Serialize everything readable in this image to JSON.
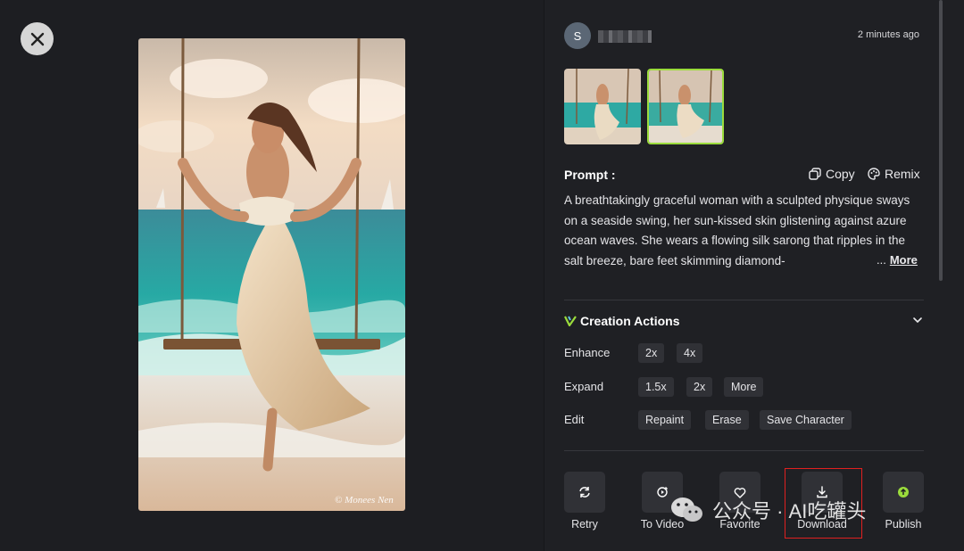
{
  "viewer": {
    "close_icon": "close-icon",
    "image_credit": "© Mοnees Nen"
  },
  "author": {
    "avatar_letter": "S",
    "timestamp": "2 minutes ago"
  },
  "prompt": {
    "title": "Prompt :",
    "copy_label": "Copy",
    "remix_label": "Remix",
    "text": "A breathtakingly graceful woman with a sculpted physique sways on a seaside swing, her sun-kissed skin glistening against azure ocean waves. She wears a flowing silk sarong that ripples in the salt breeze, bare feet skimming diamond-",
    "ellipsis": "...",
    "more_label": "More"
  },
  "creation_actions": {
    "title": "Creation Actions",
    "enhance": {
      "label": "Enhance",
      "options": [
        "2x",
        "4x"
      ]
    },
    "expand": {
      "label": "Expand",
      "options": [
        "1.5x",
        "2x",
        "More"
      ]
    },
    "edit": {
      "label": "Edit",
      "options": [
        "Repaint",
        "Erase",
        "Save Character"
      ]
    }
  },
  "actions": {
    "retry": "Retry",
    "to_video": "To Video",
    "favorite": "Favorite",
    "download": "Download",
    "publish": "Publish"
  },
  "watermark": {
    "text": "公众号 · AI吃罐头"
  },
  "colors": {
    "accent": "#9bdc3c",
    "highlight": "#e02020",
    "panel": "#1f2024",
    "chip": "#303136"
  }
}
